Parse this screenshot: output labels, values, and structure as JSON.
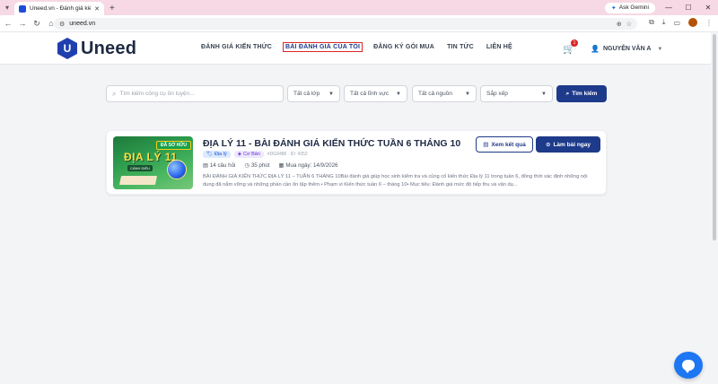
{
  "browser": {
    "tab_title": "Uneed.vn - Đánh giá kiến thức",
    "url": "uneed.vn",
    "gemini_label": "Ask Gemini"
  },
  "site": {
    "logo_text": "Uneed",
    "nav": [
      {
        "label": "ĐÁNH GIÁ KIẾN THỨC"
      },
      {
        "label": "BÀI ĐÁNH GIÁ CỦA TÔI",
        "active": true
      },
      {
        "label": "ĐĂNG KÝ GÓI MUA"
      },
      {
        "label": "TIN TỨC"
      },
      {
        "label": "LIÊN HỆ"
      }
    ],
    "cart_count": "1",
    "user_name": "NGUYỄN VĂN A"
  },
  "filters": {
    "search_placeholder": "Tìm kiếm công cụ ôn luyện...",
    "grade": "Tất cả lớp",
    "field": "Tất cả lĩnh vực",
    "source": "Tất cả nguồn",
    "sort": "Sắp xếp",
    "search_button": "Tìm kiếm"
  },
  "card": {
    "thumb_badge": "ĐÃ SỞ HỮU",
    "thumb_title": "ĐỊA LÝ 11",
    "thumb_sub": "CÁNH DIỀU",
    "title": "ĐỊA LÝ 11 - BÀI ĐÁNH GIÁ KIẾN THỨC TUẦN 6 THÁNG 10",
    "tag_subject": "Địa lý",
    "tag_level": "Cơ Bản",
    "code": "#DG9486 · ID: 4352",
    "questions": "14 câu hỏi",
    "duration": "35 phút",
    "purchase_date": "Mua ngày: 14/9/2026",
    "description": "BÀI ĐÁNH GIÁ KIẾN THỨC ĐỊA LÝ 11 – TUẦN 6 THÁNG 10Bài đánh giá giúp học sinh kiểm tra và củng cố kiến thức Địa lý 11 trong tuần 6, đồng thời xác định những nội dung đã nắm vững và những phần cần ôn tập thêm.• Phạm vi Kiến thức tuần 6 – tháng 10• Mục tiêu: Đánh giá mức độ tiếp thu và vận dụ...",
    "view_result": "Xem kết quả",
    "do_test": "Làm bài ngay"
  }
}
